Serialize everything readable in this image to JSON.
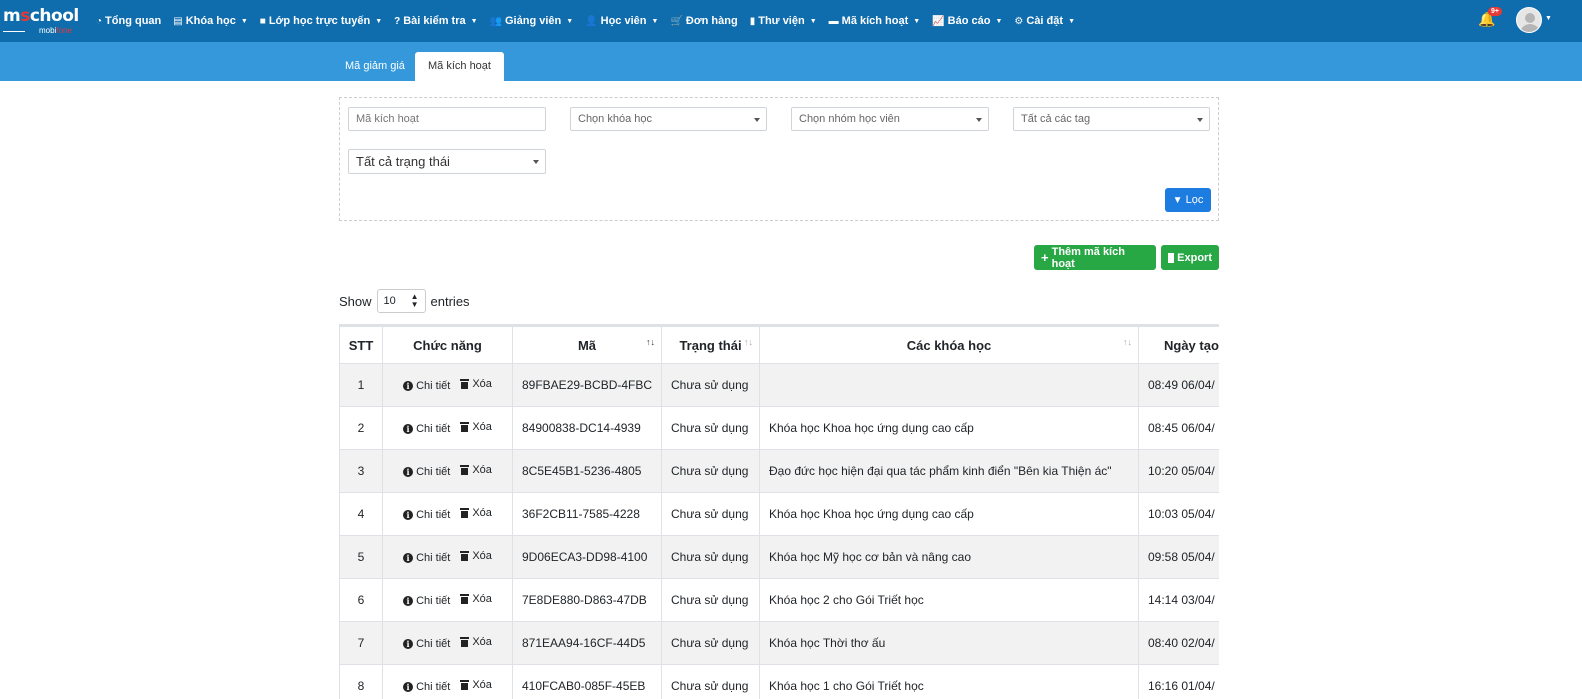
{
  "logo": {
    "brand_pre": "m",
    "brand_o": "s",
    "brand_post": "chool",
    "sub_pre": "mobi",
    "sub_post": "fone"
  },
  "nav": [
    {
      "icon": "dashboard-icon",
      "label": "Tổng quan",
      "caret": false
    },
    {
      "icon": "course-icon",
      "label": "Khóa học",
      "caret": true
    },
    {
      "icon": "video-icon",
      "label": "Lớp học trực tuyến",
      "caret": true
    },
    {
      "icon": "question-icon",
      "label": "Bài kiểm tra",
      "caret": true
    },
    {
      "icon": "users-icon",
      "label": "Giảng viên",
      "caret": true
    },
    {
      "icon": "user-icon",
      "label": "Học viên",
      "caret": true
    },
    {
      "icon": "cart-icon",
      "label": "Đơn hàng",
      "caret": false
    },
    {
      "icon": "book-icon",
      "label": "Thư viện",
      "caret": true
    },
    {
      "icon": "card-icon",
      "label": "Mã kích hoạt",
      "caret": true
    },
    {
      "icon": "chart-icon",
      "label": "Báo cáo",
      "caret": true
    },
    {
      "icon": "cogs-icon",
      "label": "Cài đặt",
      "caret": true
    }
  ],
  "notifications": {
    "count": "9+"
  },
  "tabs": [
    {
      "label": "Mã giảm giá",
      "active": false
    },
    {
      "label": "Mã kích hoạt",
      "active": true
    }
  ],
  "filters": {
    "code_placeholder": "Mã kích hoạt",
    "course_select": "Chọn khóa học",
    "group_select": "Chọn nhóm học viên",
    "tag_select": "Tất cả các tag",
    "status_select": "Tất cả trạng thái",
    "filter_button": "Lọc"
  },
  "actions": {
    "add_label": "Thêm mã kích hoạt",
    "export_label": "Export"
  },
  "entries": {
    "show": "Show",
    "value": "10",
    "suffix": "entries"
  },
  "table": {
    "headers": [
      "STT",
      "Chức năng",
      "Mã",
      "Trạng thái",
      "Các khóa học",
      "Ngày tạo"
    ],
    "detail_label": "Chi tiết",
    "delete_label": "Xóa",
    "rows": [
      {
        "stt": "1",
        "code": "89FBAE29-BCBD-4FBC",
        "status": "Chưa sử dụng",
        "courses": "",
        "created": "08:49 06/04/"
      },
      {
        "stt": "2",
        "code": "84900838-DC14-4939",
        "status": "Chưa sử dụng",
        "courses": "Khóa học Khoa học ứng dụng cao cấp",
        "created": "08:45 06/04/"
      },
      {
        "stt": "3",
        "code": "8C5E45B1-5236-4805",
        "status": "Chưa sử dụng",
        "courses": "Đạo đức học hiện đại qua tác phẩm kinh điển \"Bên kia Thiện ác\"",
        "created": "10:20 05/04/"
      },
      {
        "stt": "4",
        "code": "36F2CB11-7585-4228",
        "status": "Chưa sử dụng",
        "courses": "Khóa học Khoa học ứng dụng cao cấp",
        "created": "10:03 05/04/"
      },
      {
        "stt": "5",
        "code": "9D06ECA3-DD98-4100",
        "status": "Chưa sử dụng",
        "courses": "Khóa học Mỹ học cơ bản và nâng cao",
        "created": "09:58 05/04/"
      },
      {
        "stt": "6",
        "code": "7E8DE880-D863-47DB",
        "status": "Chưa sử dụng",
        "courses": "Khóa học 2 cho Gói Triết học",
        "created": "14:14 03/04/"
      },
      {
        "stt": "7",
        "code": "871EAA94-16CF-44D5",
        "status": "Chưa sử dụng",
        "courses": "Khóa học Thời thơ ấu",
        "created": "08:40 02/04/"
      },
      {
        "stt": "8",
        "code": "410FCAB0-085F-45EB",
        "status": "Chưa sử dụng",
        "courses": "Khóa học 1 cho Gói Triết học",
        "created": "16:16 01/04/"
      }
    ]
  }
}
